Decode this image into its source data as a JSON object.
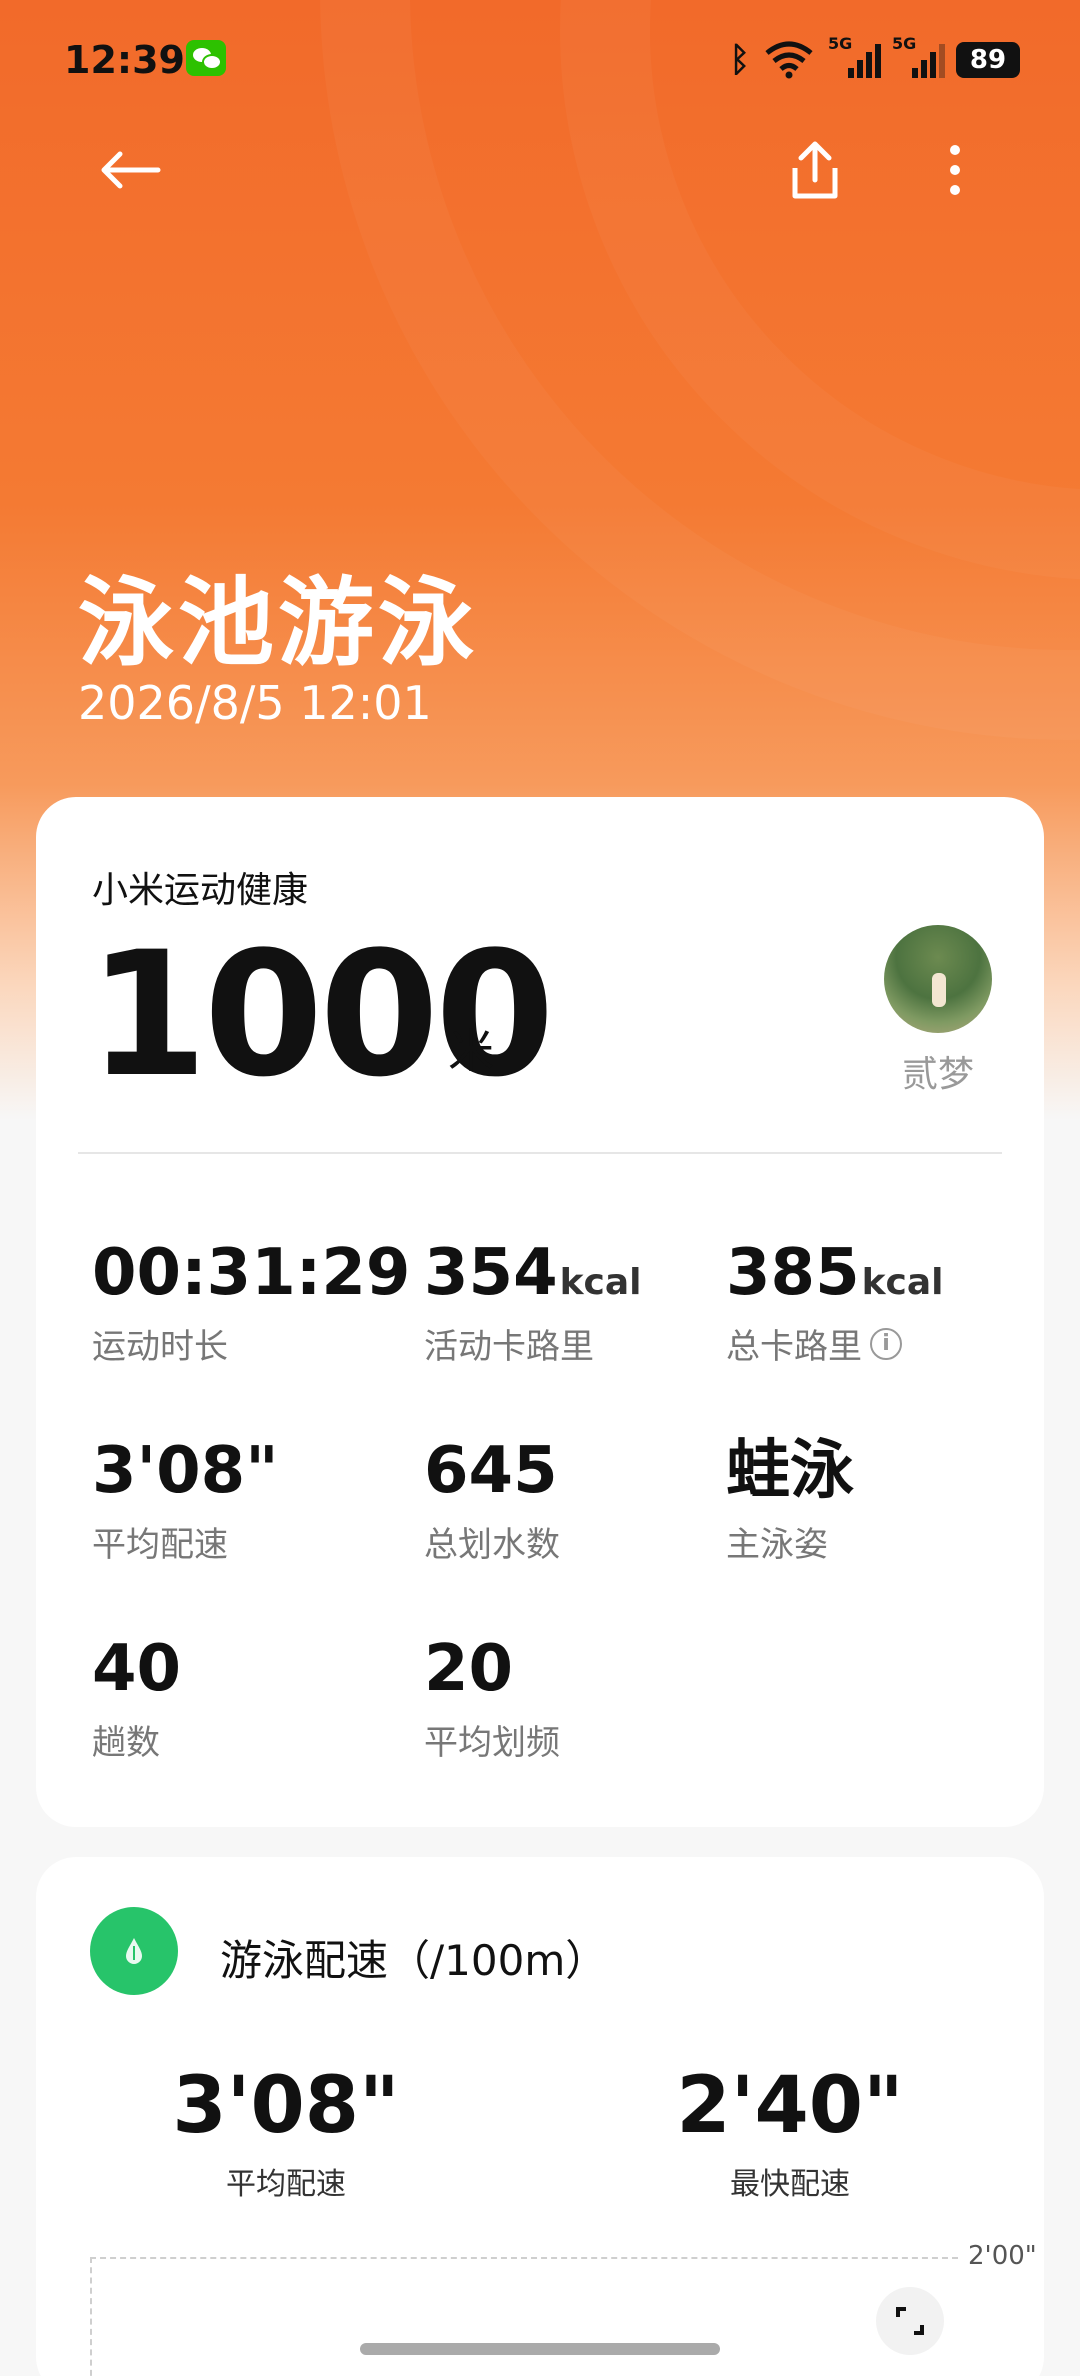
{
  "status_bar": {
    "time": "12:39",
    "battery": "89",
    "network_1": "5G",
    "network_2": "5G"
  },
  "header": {
    "title": "泳池游泳",
    "datetime": "2026/8/5 12:01"
  },
  "summary": {
    "source": "小米运动健康",
    "distance_value": "1000",
    "distance_unit": "米",
    "user_name": "贰梦",
    "stats": [
      {
        "value": "00:31:29",
        "unit": "",
        "label": "运动时长"
      },
      {
        "value": "354",
        "unit": "kcal",
        "label": "活动卡路里"
      },
      {
        "value": "385",
        "unit": "kcal",
        "label": "总卡路里"
      },
      {
        "value": "3'08\"",
        "unit": "",
        "label": "平均配速"
      },
      {
        "value": "645",
        "unit": "",
        "label": "总划水数"
      },
      {
        "value": "蛙泳",
        "unit": "",
        "label": "主泳姿"
      },
      {
        "value": "40",
        "unit": "",
        "label": "趟数"
      },
      {
        "value": "20",
        "unit": "",
        "label": "平均划频"
      }
    ]
  },
  "pace": {
    "title": "游泳配速（/100m）",
    "avg_value": "3'08\"",
    "avg_label": "平均配速",
    "fast_value": "2'40\"",
    "fast_label": "最快配速",
    "chart_tick": "2'00\""
  },
  "colors": {
    "accent": "#f26a2a",
    "pace_icon": "#27c46a"
  }
}
